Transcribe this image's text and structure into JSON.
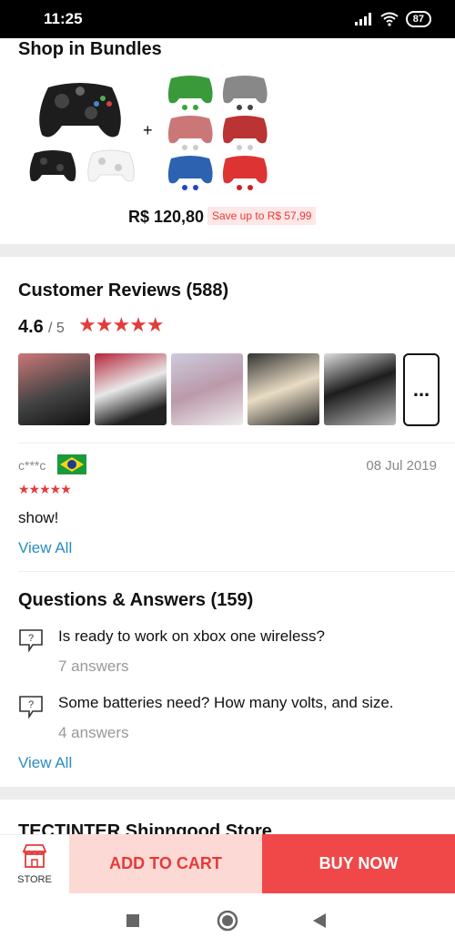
{
  "status_bar": {
    "time": "11:25",
    "battery": "87"
  },
  "bundles": {
    "title": "Shop in Bundles",
    "plus": "+",
    "price": "R$ 120,80",
    "save": "Save up to R$ 57,99"
  },
  "reviews": {
    "title": "Customer Reviews (588)",
    "rating": "4.6",
    "rating_scale": "/ 5",
    "stars": "★★★★★",
    "more": "...",
    "first": {
      "reviewer": "c***c",
      "country_flag": "brazil-flag-icon",
      "date": "08 Jul 2019",
      "stars": "★★★★★",
      "text": "show!"
    },
    "view_all": "View All"
  },
  "qa": {
    "title": "Questions & Answers (159)",
    "items": [
      {
        "question": "Is ready to work on xbox one wireless?",
        "answers": "7 answers"
      },
      {
        "question": "Some batteries need? How many volts, and size.",
        "answers": "4 answers"
      }
    ],
    "view_all": "View All"
  },
  "store_peek": "TECTINTER Shipngood Store",
  "bottom_bar": {
    "store_label": "STORE",
    "add_to_cart": "ADD TO CART",
    "buy_now": "BUY NOW"
  },
  "colors": {
    "accent": "#e43b3b",
    "link": "#2a8dbd",
    "buy": "#f04848",
    "cart_bg": "#fcd9d5"
  }
}
